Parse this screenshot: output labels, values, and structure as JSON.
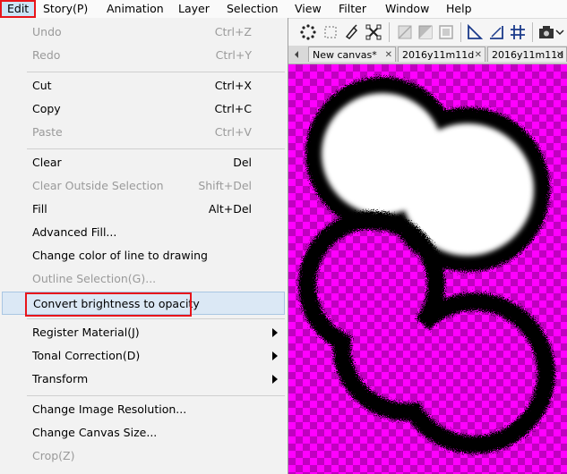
{
  "menubar": {
    "items": [
      "Edit",
      "Story(P)",
      "Animation",
      "Layer",
      "Selection",
      "View",
      "Filter",
      "Window",
      "Help"
    ]
  },
  "tabs": [
    "New canvas*",
    "2016y11m11d",
    "2016y11m11d"
  ],
  "menu": {
    "undo": {
      "label": "Undo",
      "shortcut": "Ctrl+Z"
    },
    "redo": {
      "label": "Redo",
      "shortcut": "Ctrl+Y"
    },
    "cut": {
      "label": "Cut",
      "shortcut": "Ctrl+X"
    },
    "copy": {
      "label": "Copy",
      "shortcut": "Ctrl+C"
    },
    "paste": {
      "label": "Paste",
      "shortcut": "Ctrl+V"
    },
    "clear": {
      "label": "Clear",
      "shortcut": "Del"
    },
    "clear_outside": {
      "label": "Clear Outside Selection",
      "shortcut": "Shift+Del"
    },
    "fill": {
      "label": "Fill",
      "shortcut": "Alt+Del"
    },
    "advanced_fill": {
      "label": "Advanced Fill..."
    },
    "change_line_color": {
      "label": "Change color of line to drawing"
    },
    "outline_selection": {
      "label": "Outline Selection(G)..."
    },
    "convert_brightness": {
      "label": "Convert brightness to opacity"
    },
    "register_material": {
      "label": "Register Material(J)"
    },
    "tonal_correction": {
      "label": "Tonal Correction(D)"
    },
    "transform": {
      "label": "Transform"
    },
    "change_resolution": {
      "label": "Change Image Resolution..."
    },
    "change_canvas_size": {
      "label": "Change Canvas Size..."
    },
    "crop": {
      "label": "Crop(Z)"
    }
  },
  "colors": {
    "highlight_border": "#e8151b",
    "canvas_magenta": "#ff00ff",
    "canvas_checker": "#c000c0"
  }
}
